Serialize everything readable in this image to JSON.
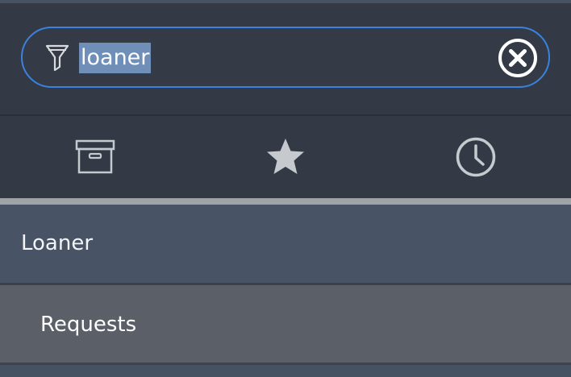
{
  "search": {
    "value": "loaner",
    "filter_icon": "filter-funnel-icon",
    "clear_icon": "clear-circle-x-icon"
  },
  "tabs": [
    {
      "icon": "archive-box-icon"
    },
    {
      "icon": "star-icon"
    },
    {
      "icon": "clock-icon"
    }
  ],
  "results": {
    "group_label": "Loaner",
    "items": [
      {
        "label": "Requests"
      }
    ]
  },
  "colors": {
    "accent": "#3b82df",
    "selection": "#6f8eb8",
    "panel": "#333a46",
    "group_bg": "#485465",
    "item_bg": "#5a5f68"
  }
}
